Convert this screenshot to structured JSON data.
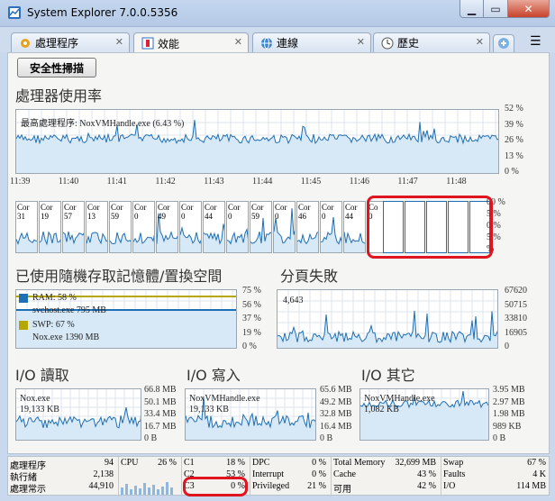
{
  "window": {
    "title": "System Explorer 7.0.0.5356"
  },
  "tabs": [
    {
      "label": "處理程序"
    },
    {
      "label": "效能"
    },
    {
      "label": "連線"
    },
    {
      "label": "歷史"
    }
  ],
  "toolbar": {
    "scan_label": "安全性掃描"
  },
  "cpu": {
    "heading": "處理器使用率",
    "top_process": "最高處理程序: NoxVMHandle.exe (6.43 %)",
    "y_ticks": [
      "52 %",
      "39 %",
      "26 %",
      "13 %",
      "0 %"
    ],
    "time_ticks": [
      "11:39",
      "11:40",
      "11:41",
      "11:42",
      "11:43",
      "11:44",
      "11:45",
      "11:46",
      "11:47",
      "11:48"
    ],
    "cores": [
      {
        "label": "Cor",
        "value": "31"
      },
      {
        "label": "Cor",
        "value": "19"
      },
      {
        "label": "Cor",
        "value": "57"
      },
      {
        "label": "Cor",
        "value": "13"
      },
      {
        "label": "Cor",
        "value": "59"
      },
      {
        "label": "Cor",
        "value": "0"
      },
      {
        "label": "Cor",
        "value": "49"
      },
      {
        "label": "Cor",
        "value": "0"
      },
      {
        "label": "Cor",
        "value": "44"
      },
      {
        "label": "Cor",
        "value": "0"
      },
      {
        "label": "Cor",
        "value": "59"
      },
      {
        "label": "Cor",
        "value": "0"
      },
      {
        "label": "Cor",
        "value": "46"
      },
      {
        "label": "Cor",
        "value": "0"
      },
      {
        "label": "Cor",
        "value": "44"
      },
      {
        "label": "Co",
        "value": "0"
      }
    ],
    "core_ticks": [
      "00 %",
      "5 %",
      "0 %",
      "5 %",
      "%"
    ]
  },
  "memory": {
    "heading": "已使用隨機存取記憶體/置換空間",
    "ram_label": "RAM: 58 %",
    "ram_proc": "svchost.exe 795 MB",
    "swp_label": "SWP: 67 %",
    "swp_proc": "Nox.exe 1390 MB",
    "y_ticks": [
      "75 %",
      "56 %",
      "37 %",
      "19 %",
      "0 %"
    ],
    "ram_color": "#1f6fb5",
    "swp_color": "#b5a700"
  },
  "pagefaults": {
    "heading": "分頁失敗",
    "value": "4,643",
    "y_ticks": [
      "67620",
      "50715",
      "33810",
      "16905",
      "0"
    ]
  },
  "io_read": {
    "heading": "I/O 讀取",
    "proc": "Nox.exe",
    "value": "19,133 KB",
    "y_ticks": [
      "66.8 MB",
      "50.1 MB",
      "33.4 MB",
      "16.7 MB",
      "0 B"
    ]
  },
  "io_write": {
    "heading": "I/O 寫入",
    "proc": "NoxVMHandle.exe",
    "value": "19,133 KB",
    "y_ticks": [
      "65.6 MB",
      "49.2 MB",
      "32.8 MB",
      "16.4 MB",
      "0 B"
    ]
  },
  "io_other": {
    "heading": "I/O 其它",
    "proc": "NoxVMHandle.exe",
    "value": "1,082 KB",
    "y_ticks": [
      "3.95 MB",
      "2.97 MB",
      "1.98 MB",
      "989 KB",
      "0 B"
    ]
  },
  "status": {
    "proc_rows": [
      {
        "k": "處理程序",
        "v": "94"
      },
      {
        "k": "執行緒",
        "v": "2,138"
      },
      {
        "k": "處理常示",
        "v": "44,910"
      }
    ],
    "cpu": {
      "k": "CPU",
      "v": "26 %"
    },
    "c_rows": [
      {
        "k": "C1",
        "v": "18 %"
      },
      {
        "k": "C2",
        "v": "53 %"
      },
      {
        "k": "C3",
        "v": "0 %"
      }
    ],
    "dpc_rows": [
      {
        "k": "DPC",
        "v": "0 %"
      },
      {
        "k": "Interrupt",
        "v": "0 %"
      },
      {
        "k": "Privileged",
        "v": "21 %"
      }
    ],
    "mem_rows": [
      {
        "k": "Total Memory",
        "v": "32,699 MB"
      },
      {
        "k": "Cache",
        "v": "43 %"
      },
      {
        "k": "可用",
        "v": "42 %"
      }
    ],
    "swap_rows": [
      {
        "k": "Swap",
        "v": "67 %"
      },
      {
        "k": "Faults",
        "v": "4 K"
      },
      {
        "k": "I/O",
        "v": "114 MB"
      }
    ]
  }
}
